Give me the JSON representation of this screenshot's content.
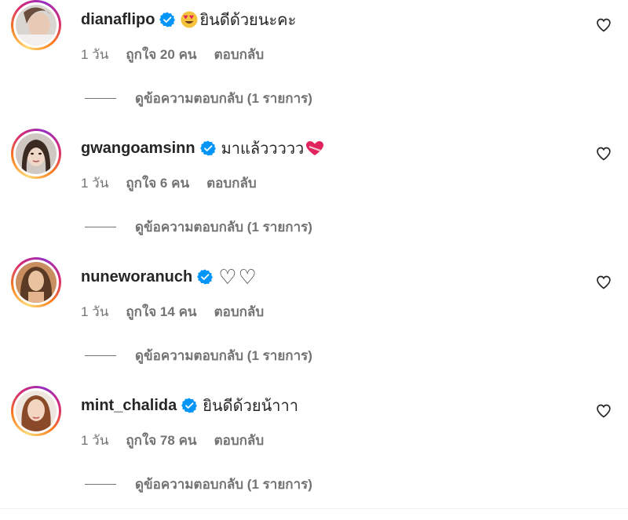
{
  "comments": [
    {
      "username": "dianaflipo",
      "verified": true,
      "emoji_before": "😍",
      "text": "ยินดีด้วยนะคะ",
      "emoji_after": "",
      "time": "1 วัน",
      "likes": "ถูกใจ 20 คน",
      "reply": "ตอบกลับ",
      "view_replies": "ดูข้อความตอบกลับ (1 รายการ)"
    },
    {
      "username": "gwangoamsinn",
      "verified": true,
      "emoji_before": "",
      "text": "มาแล้ววววว",
      "emoji_after": "❤️‍🩹",
      "time": "1 วัน",
      "likes": "ถูกใจ 6 คน",
      "reply": "ตอบกลับ",
      "view_replies": "ดูข้อความตอบกลับ (1 รายการ)"
    },
    {
      "username": "nuneworanuch",
      "verified": true,
      "emoji_before": "",
      "text": "♡♡",
      "emoji_after": "",
      "time": "1 วัน",
      "likes": "ถูกใจ 14 คน",
      "reply": "ตอบกลับ",
      "view_replies": "ดูข้อความตอบกลับ (1 รายการ)"
    },
    {
      "username": "mint_chalida",
      "verified": true,
      "emoji_before": "",
      "text": "ยินดีด้วยน้าาา",
      "emoji_after": "",
      "time": "1 วัน",
      "likes": "ถูกใจ 78 คน",
      "reply": "ตอบกลับ",
      "view_replies": "ดูข้อความตอบกลับ (1 รายการ)"
    }
  ],
  "icons": {
    "verified": "verified-badge-icon",
    "like": "heart-outline-icon"
  },
  "colors": {
    "verified": "#0095f6",
    "text": "#262626",
    "secondary": "#737373",
    "heart_emoji": "#e0245e"
  }
}
